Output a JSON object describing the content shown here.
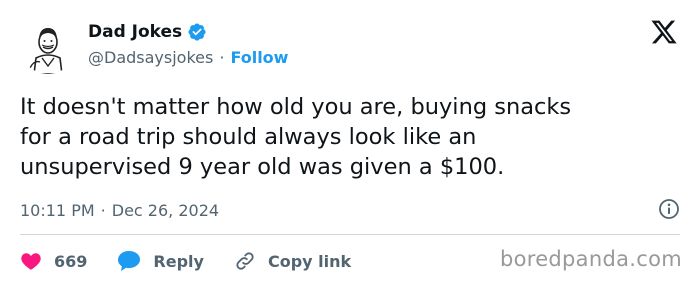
{
  "author": {
    "display_name": "Dad Jokes",
    "handle": "@Dadsaysjokes",
    "separator": "·",
    "follow_label": "Follow",
    "verified_color": "#1d9bf0"
  },
  "tweet": {
    "text": "It doesn't matter how old you are, buying snacks\nfor a road trip should always look like an\nunsupervised 9 year old was given a $100.",
    "time": "10:11 PM",
    "separator": "·",
    "date": "Dec 26, 2024"
  },
  "actions": {
    "likes": "669",
    "reply_label": "Reply",
    "copy_link_label": "Copy link"
  },
  "watermark": "boredpanda.com",
  "colors": {
    "like": "#f91880",
    "reply": "#1d9bf0",
    "accent": "#1d9bf0",
    "muted": "#536471"
  }
}
